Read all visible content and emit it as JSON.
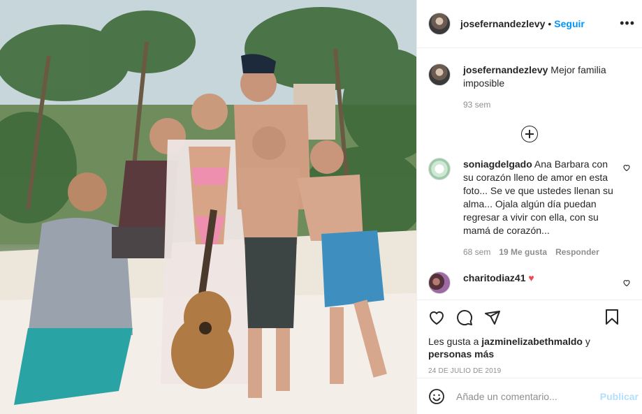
{
  "photo": {
    "alt_icon": "beach-family-photo"
  },
  "header": {
    "username": "josefernandezlevy",
    "separator": "•",
    "follow_label": "Seguir",
    "more_icon": "more-options-icon"
  },
  "caption": {
    "username": "josefernandezlevy",
    "text": "Mejor familia imposible",
    "age": "93 sem"
  },
  "load_more_icon": "add-circle-icon",
  "comments": [
    {
      "username": "soniagdelgado",
      "text": "Ana Barbara con su corazón lleno de amor en esta foto... Se ve que ustedes llenan su alma... Ojala algún día puedan regresar a vivir con ella, con su mamá de corazón...",
      "age": "68 sem",
      "likes": "19 Me gusta",
      "reply_label": "Responder"
    },
    {
      "username": "charitodiaz41",
      "emoji": "♥"
    }
  ],
  "actions": {
    "like_icon": "heart-icon",
    "comment_icon": "comment-icon",
    "share_icon": "send-icon",
    "save_icon": "bookmark-icon"
  },
  "likes": {
    "prefix": "Les gusta a ",
    "user": "jazminelizabethmaldo",
    "middle": " y",
    "others": "personas más"
  },
  "date": "24 DE JULIO DE 2019",
  "add_comment": {
    "emoji_icon": "smiley-icon",
    "placeholder": "Añade un comentario...",
    "post_label": "Publicar"
  },
  "colors": {
    "accent": "#0095f6",
    "post_disabled": "#b2dffc",
    "heart_red": "#ed4956",
    "muted": "#8e8e8e"
  }
}
